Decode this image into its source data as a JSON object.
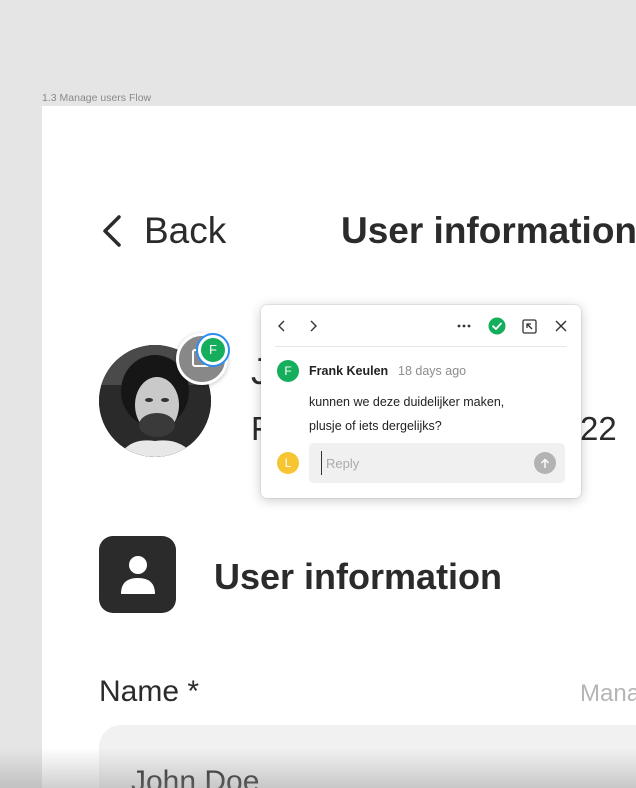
{
  "frame": {
    "label": "1.3 Manage users Flow"
  },
  "header": {
    "back_label": "Back",
    "title": "User information"
  },
  "profile": {
    "name_partial": "J",
    "subtitle_partial": "F",
    "number_partial": "22"
  },
  "section": {
    "title": "User information"
  },
  "form": {
    "name_label": "Name *",
    "name_hint": "Mana",
    "name_value": "John Doe"
  },
  "pin": {
    "badge_initial": "F"
  },
  "comment": {
    "author_initial": "F",
    "author": "Frank Keulen",
    "time": "18 days ago",
    "line1": "kunnen we deze duidelijker maken,",
    "line2": "plusje of iets dergelijks?",
    "reply_avatar_initial": "L",
    "reply_placeholder": "Reply",
    "colors": {
      "author_avatar": "#14ae5c",
      "reply_avatar": "#f7c531",
      "resolve": "#14ae5c"
    }
  },
  "icons": {
    "prev": "chevron-left-icon",
    "next": "chevron-right-icon",
    "more": "ellipsis-icon",
    "resolve": "check-circle-icon",
    "popout": "popout-icon",
    "close": "close-icon",
    "send": "arrow-up-icon"
  }
}
